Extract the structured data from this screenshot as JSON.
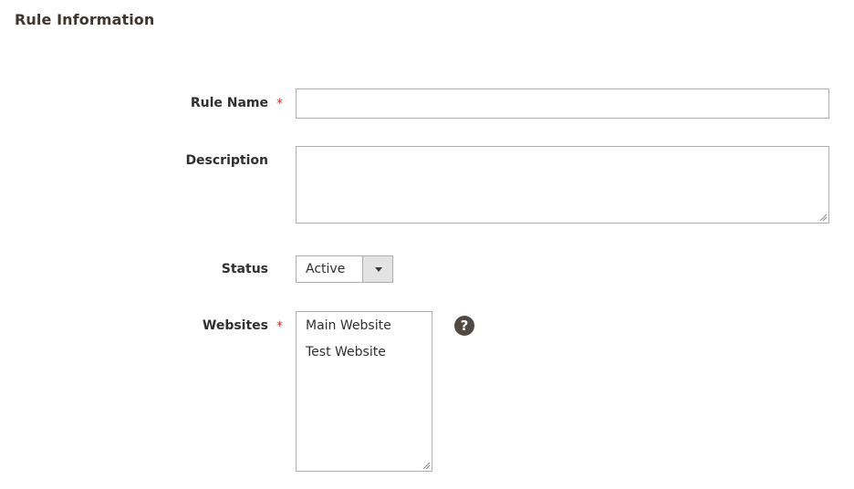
{
  "section": {
    "title": "Rule Information"
  },
  "fields": {
    "rule_name": {
      "label": "Rule Name",
      "required_mark": "*",
      "value": ""
    },
    "description": {
      "label": "Description",
      "value": ""
    },
    "status": {
      "label": "Status",
      "selected": "Active"
    },
    "websites": {
      "label": "Websites",
      "required_mark": "*",
      "options": [
        "Main Website",
        "Test Website"
      ],
      "help_glyph": "?"
    }
  },
  "icons": {
    "status_dropdown": "chevron-down-icon",
    "websites_help": "question-circle-icon",
    "textarea_resize": "resize-grip-icon"
  },
  "colors": {
    "required": "#e22626",
    "help_icon_bg": "#514943",
    "border": "#adadad",
    "select_arrow_bg": "#e3e3e3"
  }
}
